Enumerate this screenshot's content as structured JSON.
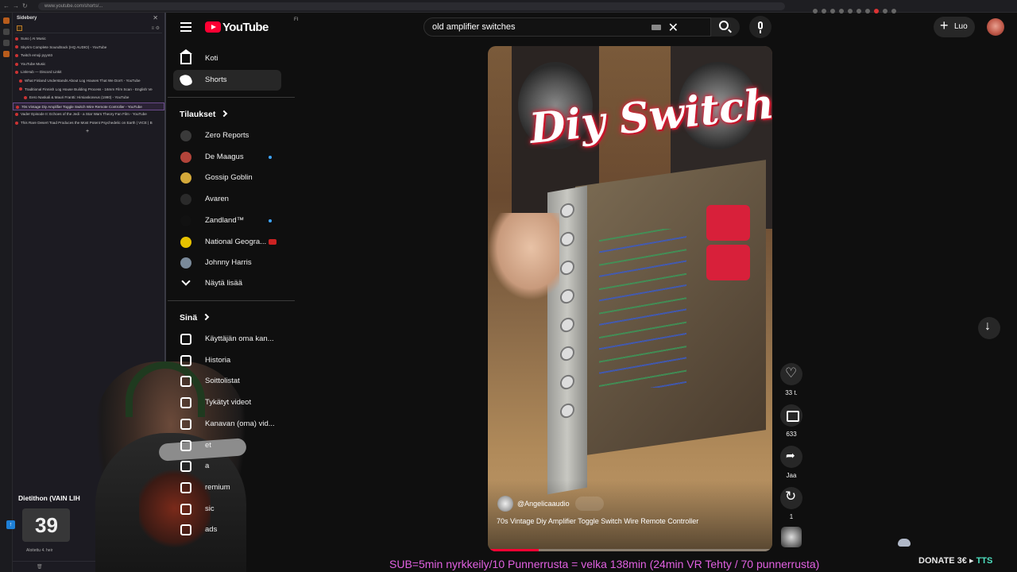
{
  "browser": {
    "url": "www.youtube.com/shorts/..."
  },
  "sidebery": {
    "title": "Sidebery",
    "tabs": [
      {
        "label": "Suno | AI Music",
        "active": false
      },
      {
        "label": "Skyrim Complete Soundtrack (HQ AUDIO) - YouTube",
        "active": false
      },
      {
        "label": "Twitch emoji pyyntö",
        "active": false
      },
      {
        "label": "YouTube Music",
        "active": false
      },
      {
        "label": "LinkHub — Discord Linkit",
        "active": false
      },
      {
        "label": "What Finland Understands About Log Houses That We Don't - YouTube",
        "active": false
      },
      {
        "label": "Traditional Finnish Log House Building Process - 16mm Film Scan - English Ve",
        "active": false
      },
      {
        "label": "Eero Naskali & Mauri Frantti: Hirsiaskoneus (1990) - YouTube",
        "active": false
      },
      {
        "label": "70s Vintage Diy Amplifier Toggle Switch Wire Remote Controller - YouTube",
        "active": true
      },
      {
        "label": "Vader Episode II: Echoes of the Jedi - a Star Wars Theory Fan Film - YouTube",
        "active": false
      },
      {
        "label": "This Rare Desert Toad Produces the Most Potent Psychedelic on Earth | VICE | B",
        "active": false
      }
    ],
    "add_tab": "+",
    "overlay_title": "Dietithon (VAIN LIH",
    "counter_value": "39",
    "bottom_text": "Aloitettu 4. heir"
  },
  "topbar": {
    "logo_text": "YouTube",
    "region": "FI",
    "search_query": "old amplifier switches",
    "create_label": "Luo"
  },
  "guide": {
    "home": "Koti",
    "shorts": "Shorts",
    "subscriptions_heading": "Tilaukset",
    "subscriptions": [
      {
        "name": "Zero Reports",
        "color": "#3a3a3a",
        "live": "none"
      },
      {
        "name": "De Maagus",
        "color": "#b2443a",
        "live": "dot"
      },
      {
        "name": "Gossip Goblin",
        "color": "#d4a93a",
        "live": "none"
      },
      {
        "name": "Avaren",
        "color": "#2a2a2a",
        "live": "none"
      },
      {
        "name": "Zandland™",
        "color": "#111111",
        "live": "dot"
      },
      {
        "name": "National Geogra...",
        "color": "#e7c200",
        "live": "red"
      },
      {
        "name": "Johnny Harris",
        "color": "#7a8a9a",
        "live": "none"
      }
    ],
    "show_more": "Näytä lisää",
    "you_heading": "Sinä",
    "you_items": [
      "Käyttäjän oma kan...",
      "Historia",
      "Soittolistat",
      "Tykätyt videot",
      "Kanavan (oma) vid...",
      "et",
      "a",
      "remium",
      "sic",
      "ads"
    ]
  },
  "short": {
    "overlay_text": "Diy Switch",
    "channel": "@Angelicaaudio",
    "title": "70s Vintage Diy Amplifier Toggle Switch Wire Remote Controller",
    "progress": 0.18
  },
  "actions": {
    "likes": "33 t.",
    "comments": "633",
    "share": "Jaa",
    "remix": "1"
  },
  "stream": {
    "ticker": "SUB=5min nyrkkeily/10 Punnerrusta = velka 138min (24min VR Tehty / 70 punnerrusta)",
    "donate": "DONATE 3€",
    "tts": "TTS"
  }
}
